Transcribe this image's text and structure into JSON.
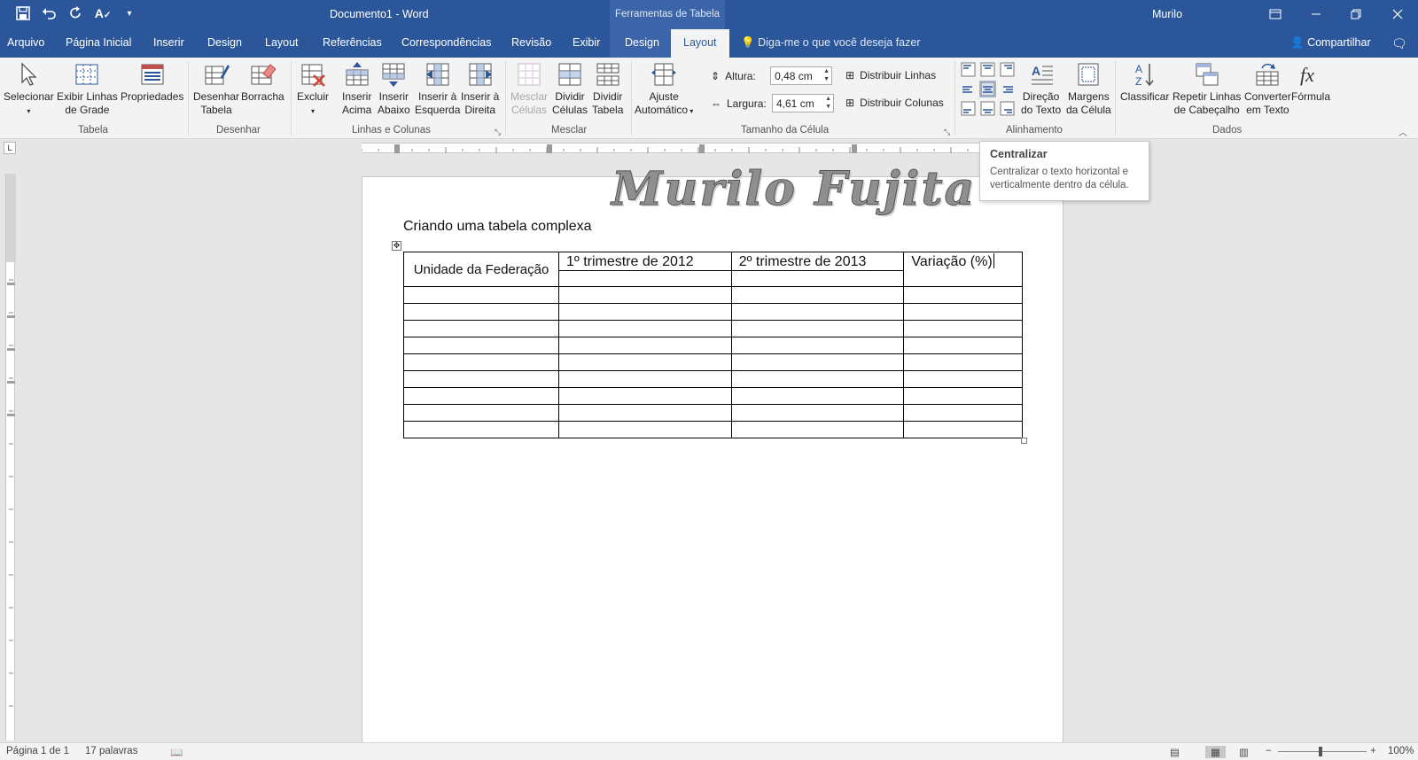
{
  "title_bar": {
    "document_title": "Documento1  -  Word",
    "context_title": "Ferramentas de Tabela",
    "user": "Murilo",
    "qat_icons": [
      "save-icon",
      "undo-icon",
      "redo-icon",
      "spelling-icon",
      "customize-qat-icon"
    ]
  },
  "tabs": [
    {
      "label": "Arquivo"
    },
    {
      "label": "Página Inicial"
    },
    {
      "label": "Inserir"
    },
    {
      "label": "Design"
    },
    {
      "label": "Layout"
    },
    {
      "label": "Referências"
    },
    {
      "label": "Correspondências"
    },
    {
      "label": "Revisão"
    },
    {
      "label": "Exibir"
    },
    {
      "label": "Design"
    },
    {
      "label": "Layout",
      "active": true
    }
  ],
  "tell_me": "Diga-me o que você deseja fazer",
  "share": "Compartilhar",
  "ribbon": {
    "groups": {
      "tabela": "Tabela",
      "desenhar": "Desenhar",
      "linhas_colunas": "Linhas e Colunas",
      "mesclar": "Mesclar",
      "tamanho": "Tamanho da Célula",
      "alinhamento": "Alinhamento",
      "dados": "Dados"
    },
    "buttons": {
      "selecionar": "Selecionar",
      "exibir_linhas_1": "Exibir Linhas",
      "exibir_linhas_2": "de Grade",
      "propriedades": "Propriedades",
      "desenhar_1": "Desenhar",
      "desenhar_2": "Tabela",
      "borracha": "Borracha",
      "excluir": "Excluir",
      "inserir_acima_1": "Inserir",
      "inserir_acima_2": "Acima",
      "inserir_abaixo_1": "Inserir",
      "inserir_abaixo_2": "Abaixo",
      "inserir_esq_1": "Inserir à",
      "inserir_esq_2": "Esquerda",
      "inserir_dir_1": "Inserir à",
      "inserir_dir_2": "Direita",
      "mesclar_1": "Mesclar",
      "mesclar_2": "Células",
      "dividir_cel_1": "Dividir",
      "dividir_cel_2": "Células",
      "dividir_tab_1": "Dividir",
      "dividir_tab_2": "Tabela",
      "ajuste_1": "Ajuste",
      "ajuste_2": "Automático",
      "distribuir_linhas": "Distribuir Linhas",
      "distribuir_colunas": "Distribuir Colunas",
      "direcao_1": "Direção",
      "direcao_2": "do Texto",
      "margens_1": "Margens",
      "margens_2": "da Célula",
      "classificar": "Classificar",
      "repetir_1": "Repetir Linhas",
      "repetir_2": "de Cabeçalho",
      "converter_1": "Converter",
      "converter_2": "em Texto",
      "formula": "Fórmula"
    },
    "altura_label": "Altura:",
    "altura_value": "0,48 cm",
    "largura_label": "Largura:",
    "largura_value": "4,61 cm"
  },
  "tooltip": {
    "title": "Centralizar",
    "description_1": "Centralizar o texto horizontal e",
    "description_2": "verticalmente dentro da célula."
  },
  "document": {
    "watermark": "Murilo Fujita",
    "heading": "Criando uma tabela complexa",
    "table": {
      "col1": "Unidade da Federação",
      "col2": "1º trimestre de 2012",
      "col3": "2º trimestre de 2013",
      "col4": "Variação (%)",
      "empty_rows": 9
    }
  },
  "status_bar": {
    "page": "Página 1 de 1",
    "words": "17 palavras",
    "zoom": "100%"
  }
}
